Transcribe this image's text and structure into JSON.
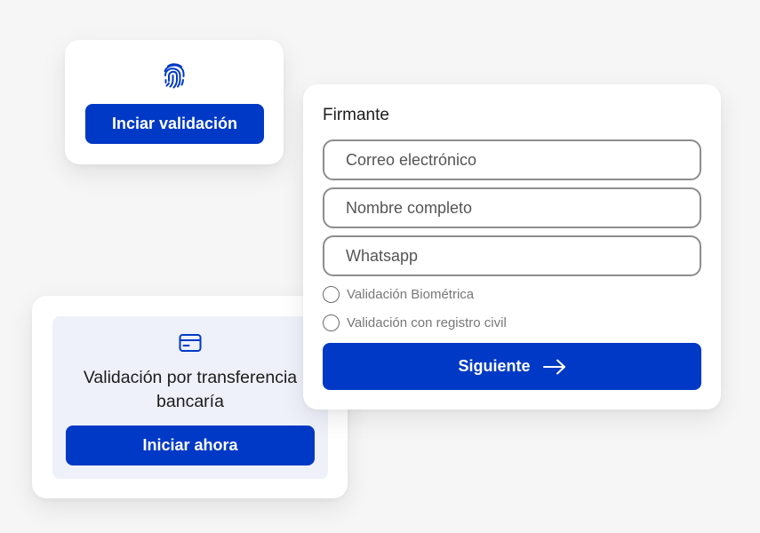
{
  "biometric_card": {
    "icon": "fingerprint-icon",
    "button_label": "Inciar validación"
  },
  "bank_card": {
    "icon": "credit-card-icon",
    "title_line1": "Validación por transferencia",
    "title_line2": "bancaría",
    "button_label": "Iniciar ahora"
  },
  "form_card": {
    "heading": "Firmante",
    "fields": [
      {
        "placeholder": "Correo electrónico",
        "value": ""
      },
      {
        "placeholder": "Nombre completo",
        "value": ""
      },
      {
        "placeholder": "Whatsapp",
        "value": ""
      }
    ],
    "options": [
      {
        "label": "Validación Biométrica",
        "selected": false
      },
      {
        "label": "Validación con registro civil",
        "selected": false
      }
    ],
    "submit_label": "Siguiente",
    "submit_icon": "arrow-right-icon"
  },
  "colors": {
    "accent": "#0039c5",
    "background": "#f6f6f6",
    "card": "#ffffff",
    "inner_panel": "#eef1fa"
  }
}
